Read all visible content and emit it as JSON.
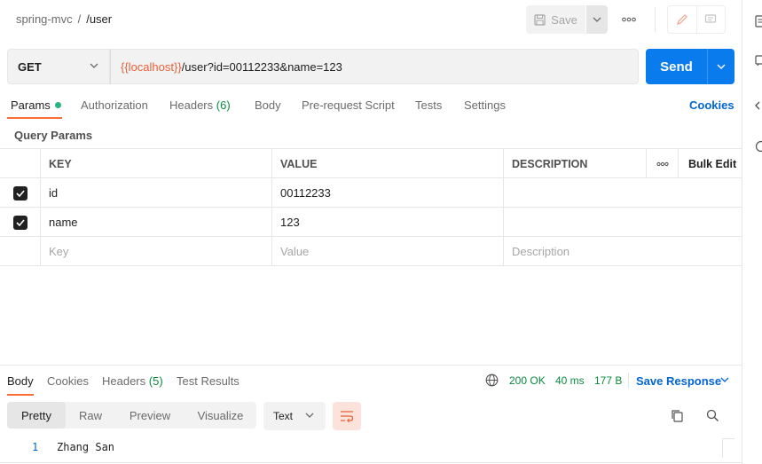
{
  "breadcrumb": {
    "collection": "spring-mvc",
    "separator": "/",
    "request": "/user"
  },
  "toolbar": {
    "save_label": "Save",
    "more_icon": "ooo"
  },
  "request": {
    "method": "GET",
    "url_variable": "{{localhost}}",
    "url_path": "/user?id=00112233&name=123",
    "send_label": "Send"
  },
  "tabs": {
    "params": "Params",
    "authorization": "Authorization",
    "headers": "Headers",
    "headers_count": "(6)",
    "body": "Body",
    "prerequest": "Pre-request Script",
    "tests": "Tests",
    "settings": "Settings",
    "cookies": "Cookies"
  },
  "query_params": {
    "title": "Query Params",
    "headers": {
      "key": "KEY",
      "value": "VALUE",
      "description": "DESCRIPTION",
      "dots": "ooo",
      "bulk_edit": "Bulk Edit"
    },
    "rows": [
      {
        "key": "id",
        "value": "00112233",
        "description": "",
        "checked": true
      },
      {
        "key": "name",
        "value": "123",
        "description": "",
        "checked": true
      }
    ],
    "placeholder": {
      "key": "Key",
      "value": "Value",
      "description": "Description"
    }
  },
  "response": {
    "tabs": {
      "body": "Body",
      "cookies": "Cookies",
      "headers": "Headers",
      "headers_count": "(5)",
      "test_results": "Test Results"
    },
    "status": "200 OK",
    "time": "40 ms",
    "size": "177 B",
    "save_response": "Save Response",
    "views": {
      "pretty": "Pretty",
      "raw": "Raw",
      "preview": "Preview",
      "visualize": "Visualize"
    },
    "format": "Text",
    "lines": [
      {
        "num": "1",
        "text": "Zhang San"
      }
    ]
  },
  "colors": {
    "accent": "#ff6c37",
    "primary": "#097bed",
    "success": "#0a8a3e",
    "variable": "#e8613a"
  }
}
